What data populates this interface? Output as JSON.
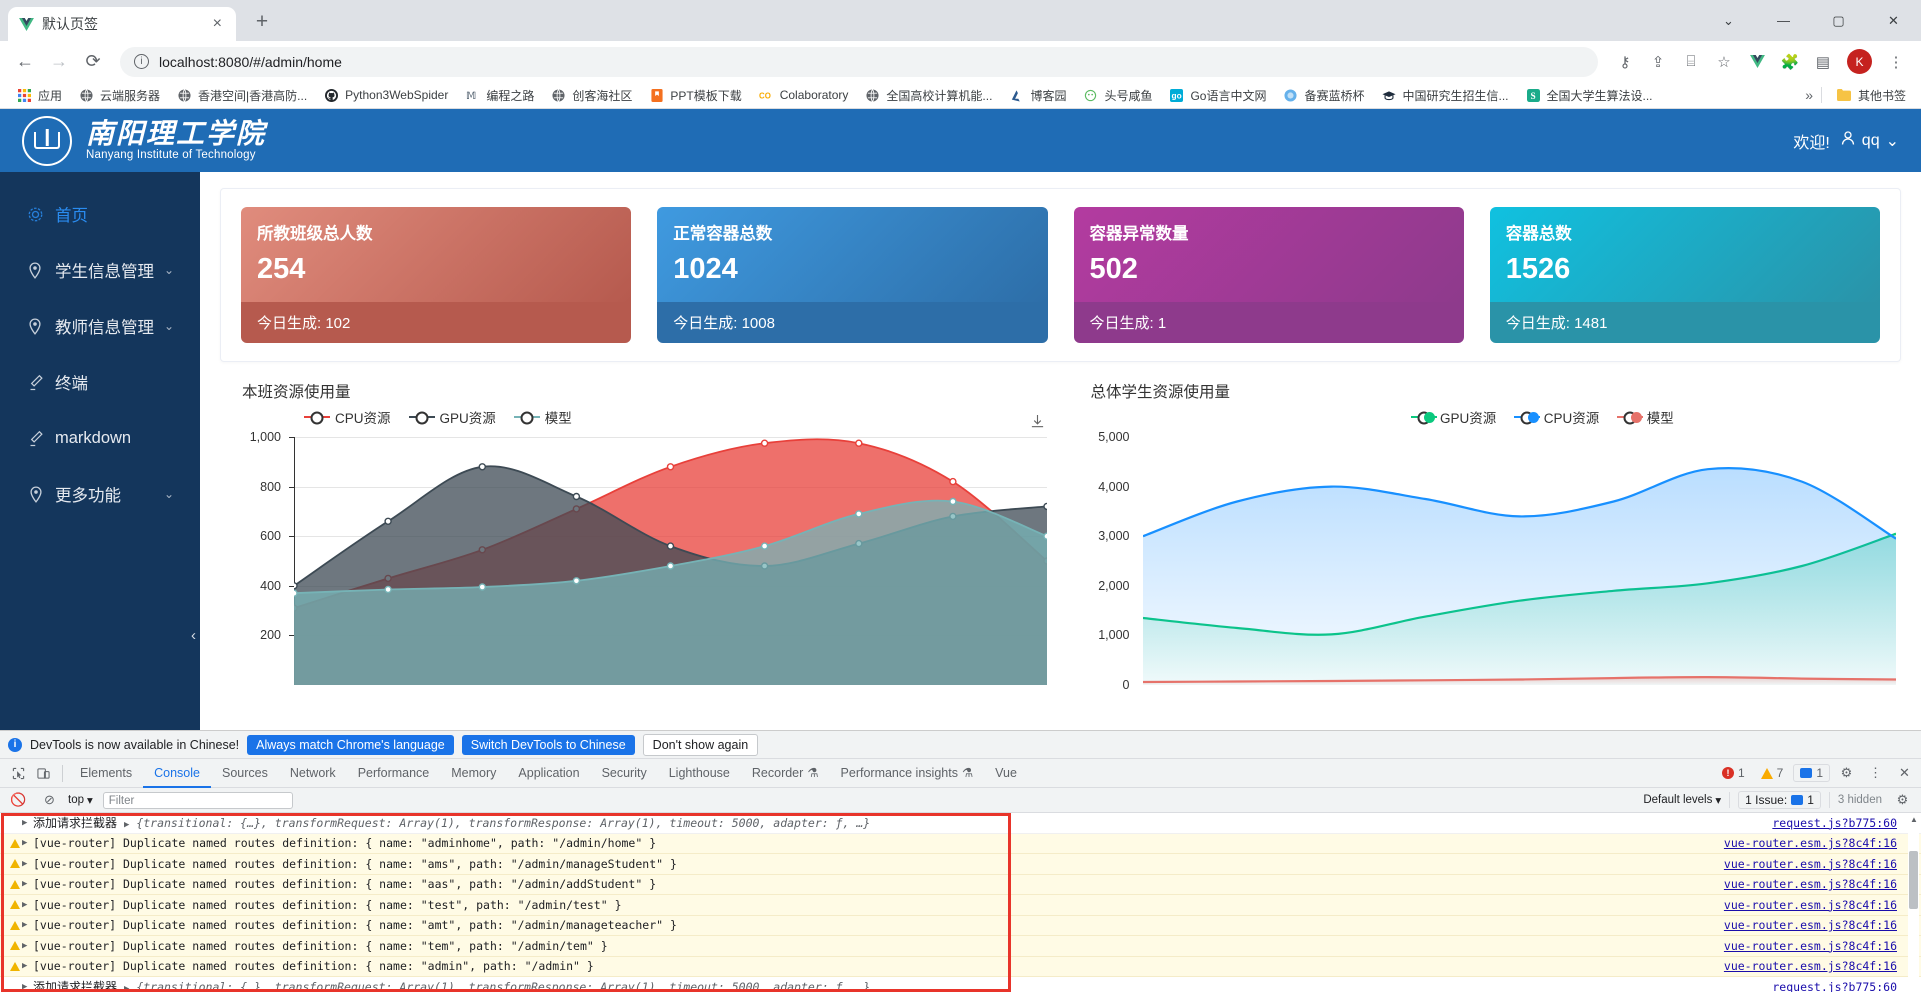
{
  "browser": {
    "tab": {
      "title": "默认页签",
      "favicon": "vue-logo-icon",
      "close": "×"
    },
    "newtab_label": "+",
    "window_controls": {
      "minimize": "—",
      "maximize": "▢",
      "close": "✕",
      "chevron": "⌄"
    },
    "nav": {
      "back": "←",
      "forward": "→",
      "reload": "⟳"
    },
    "omnibox": {
      "host": "localhost:8080",
      "path": "/#/admin/home",
      "full": "localhost:8080/#/admin/home",
      "info_icon": "ⓘ"
    },
    "toolbar_icons": [
      "key-icon",
      "share-icon",
      "cast-icon",
      "star-icon",
      "vue-devtools-icon",
      "extensions-icon",
      "sidepanel-icon"
    ],
    "profile_initials": "K",
    "bookmarks": [
      {
        "label": "应用",
        "icon": "apps-grid-icon"
      },
      {
        "label": "云端服务器",
        "icon": "globe-icon"
      },
      {
        "label": "香港空间|香港高防...",
        "icon": "globe-icon"
      },
      {
        "label": "Python3WebSpider",
        "icon": "github-icon"
      },
      {
        "label": "编程之路",
        "icon": "site-icon"
      },
      {
        "label": "创客海社区",
        "icon": "globe-icon"
      },
      {
        "label": "PPT模板下载",
        "icon": "orange-square-icon"
      },
      {
        "label": "Colaboratory",
        "icon": "colab-icon"
      },
      {
        "label": "全国高校计算机能...",
        "icon": "globe-icon"
      },
      {
        "label": "博客园",
        "icon": "cnblogs-icon"
      },
      {
        "label": "头号咸鱼",
        "icon": "fish-icon"
      },
      {
        "label": "Go语言中文网",
        "icon": "go-icon"
      },
      {
        "label": "备赛蓝桥杯",
        "icon": "blue-circle-icon"
      },
      {
        "label": "中国研究生招生信...",
        "icon": "graduation-cap-icon"
      },
      {
        "label": "全国大学生算法设...",
        "icon": "s-square-icon"
      }
    ],
    "bookmarks_overflow": "»",
    "other_bookmarks": {
      "label": "其他书签",
      "icon": "folder-icon"
    }
  },
  "app": {
    "header": {
      "brand_cn": "南阳理工学院",
      "brand_en": "Nanyang Institute of Technology",
      "welcome": "欢迎!",
      "user": "qq",
      "user_icon": "user-icon",
      "caret": "⌄"
    },
    "sidebar": {
      "collapse_icon": "‹",
      "items": [
        {
          "label": "首页",
          "icon": "gear-icon",
          "active": true,
          "caret": ""
        },
        {
          "label": "学生信息管理",
          "icon": "location-pin-icon",
          "active": false,
          "caret": "⌄"
        },
        {
          "label": "教师信息管理",
          "icon": "location-pin-icon",
          "active": false,
          "caret": "⌄"
        },
        {
          "label": "终端",
          "icon": "pencil-icon",
          "active": false,
          "caret": ""
        },
        {
          "label": "markdown",
          "icon": "pencil-icon",
          "active": false,
          "caret": ""
        },
        {
          "label": "更多功能",
          "icon": "location-pin-icon",
          "active": false,
          "caret": "⌄"
        }
      ]
    },
    "cards": [
      {
        "title": "所教班级总人数",
        "value": "254",
        "foot": "今日生成: 102",
        "c1": "#e08c7d",
        "c2": "#b65a4e"
      },
      {
        "title": "正常容器总数",
        "value": "1024",
        "foot": "今日生成: 1008",
        "c1": "#3f9ae0",
        "c2": "#2d6ea8"
      },
      {
        "title": "容器异常数量",
        "value": "502",
        "foot": "今日生成: 1",
        "c1": "#b33ba0",
        "c2": "#8e3a8c"
      },
      {
        "title": "容器总数",
        "value": "1526",
        "foot": "今日生成: 1481",
        "c1": "#10c1e0",
        "c2": "#2a93a8"
      }
    ],
    "download_icon": "download-icon"
  },
  "chart_data": [
    {
      "type": "area",
      "title": "本班资源使用量",
      "xlabel": "",
      "ylabel": "",
      "ylim": [
        0,
        1000
      ],
      "yticks": [
        "200",
        "400",
        "600",
        "800",
        "1,000"
      ],
      "grid": true,
      "legend_position": "top",
      "x": [
        0,
        1,
        2,
        3,
        4,
        5,
        6,
        7,
        8
      ],
      "series": [
        {
          "name": "CPU资源",
          "color": "#e8403a",
          "values": [
            310,
            430,
            545,
            710,
            880,
            975,
            975,
            820,
            500
          ]
        },
        {
          "name": "GPU资源",
          "color": "#3d4a54",
          "values": [
            400,
            660,
            880,
            760,
            560,
            480,
            570,
            680,
            720
          ]
        },
        {
          "name": "模型",
          "color": "#76b3b6",
          "values": [
            370,
            385,
            395,
            420,
            480,
            560,
            690,
            740,
            600
          ]
        }
      ]
    },
    {
      "type": "area",
      "title": "总体学生资源使用量",
      "xlabel": "",
      "ylabel": "",
      "ylim": [
        0,
        5000
      ],
      "yticks": [
        "0",
        "1,000",
        "2,000",
        "3,000",
        "4,000",
        "5,000"
      ],
      "grid": false,
      "legend_position": "top",
      "x": [
        0,
        1,
        2,
        3,
        4,
        5,
        6,
        7,
        8
      ],
      "series": [
        {
          "name": "GPU资源",
          "color": "#0ac97e",
          "values": [
            1350,
            1150,
            1020,
            1380,
            1700,
            1900,
            2050,
            2400,
            3050
          ]
        },
        {
          "name": "CPU资源",
          "color": "#1890ff",
          "values": [
            3000,
            3700,
            4000,
            3750,
            3400,
            3700,
            4350,
            4100,
            2950
          ]
        },
        {
          "name": "模型",
          "color": "#e6726a",
          "values": [
            60,
            70,
            80,
            95,
            110,
            140,
            160,
            130,
            110
          ]
        }
      ]
    }
  ],
  "devtools": {
    "banner": {
      "text": "DevTools is now available in Chinese!",
      "info_badge": "i",
      "btn_always": "Always match Chrome's language",
      "btn_switch": "Switch DevTools to Chinese",
      "btn_dismiss": "Don't show again"
    },
    "tabs": [
      {
        "label": "Elements",
        "selected": false
      },
      {
        "label": "Console",
        "selected": true
      },
      {
        "label": "Sources",
        "selected": false
      },
      {
        "label": "Network",
        "selected": false
      },
      {
        "label": "Performance",
        "selected": false
      },
      {
        "label": "Memory",
        "selected": false
      },
      {
        "label": "Application",
        "selected": false
      },
      {
        "label": "Security",
        "selected": false
      },
      {
        "label": "Lighthouse",
        "selected": false
      },
      {
        "label": "Recorder",
        "selected": false,
        "beaker": true
      },
      {
        "label": "Performance insights",
        "selected": false,
        "beaker": true
      },
      {
        "label": "Vue",
        "selected": false
      }
    ],
    "counters": {
      "errors": "1",
      "warnings": "7",
      "messages": "1"
    },
    "settings_icon": "gear-icon",
    "more_icon": "kebab-icon",
    "close_icon": "close-icon",
    "inspect_icon": "inspect-icon",
    "device_icon": "device-toolbar-icon",
    "filterbar": {
      "clear_icon": "clear-console-icon",
      "noblock_icon": "no-block-icon",
      "context": "top",
      "context_caret": "▾",
      "filter_placeholder": "Filter",
      "levels": "Default levels",
      "levels_caret": "▾",
      "issues": "1 Issue:",
      "issues_count": "1",
      "hidden": "3 hidden",
      "settings_icon": "gear-icon"
    },
    "logs": [
      {
        "kind": "info",
        "arrow": "▶",
        "cn": "添加请求拦截器",
        "text": "{transitional: {…}, transformRequest: Array(1), transformResponse: Array(1), timeout: 5000, adapter: ƒ, …}",
        "src": "request.js?b775:60"
      },
      {
        "kind": "warn",
        "arrow": "▶",
        "cn": "",
        "text": "[vue-router] Duplicate named routes definition: { name: \"adminhome\", path: \"/admin/home\" }",
        "src": "vue-router.esm.js?8c4f:16"
      },
      {
        "kind": "warn",
        "arrow": "▶",
        "cn": "",
        "text": "[vue-router] Duplicate named routes definition: { name: \"ams\", path: \"/admin/manageStudent\" }",
        "src": "vue-router.esm.js?8c4f:16"
      },
      {
        "kind": "warn",
        "arrow": "▶",
        "cn": "",
        "text": "[vue-router] Duplicate named routes definition: { name: \"aas\", path: \"/admin/addStudent\" }",
        "src": "vue-router.esm.js?8c4f:16"
      },
      {
        "kind": "warn",
        "arrow": "▶",
        "cn": "",
        "text": "[vue-router] Duplicate named routes definition: { name: \"test\", path: \"/admin/test\" }",
        "src": "vue-router.esm.js?8c4f:16"
      },
      {
        "kind": "warn",
        "arrow": "▶",
        "cn": "",
        "text": "[vue-router] Duplicate named routes definition: { name: \"amt\", path: \"/admin/manageteacher\" }",
        "src": "vue-router.esm.js?8c4f:16"
      },
      {
        "kind": "warn",
        "arrow": "▶",
        "cn": "",
        "text": "[vue-router] Duplicate named routes definition: { name: \"tem\", path: \"/admin/tem\" }",
        "src": "vue-router.esm.js?8c4f:16"
      },
      {
        "kind": "warn",
        "arrow": "▶",
        "cn": "",
        "text": "[vue-router] Duplicate named routes definition: { name: \"admin\", path: \"/admin\" }",
        "src": "vue-router.esm.js?8c4f:16"
      },
      {
        "kind": "info",
        "arrow": "▶",
        "cn": "添加请求拦截器",
        "text": "{transitional: {…}, transformRequest: Array(1), transformResponse: Array(1), timeout: 5000, adapter: ƒ, …}",
        "src": "request.js?b775:60"
      }
    ]
  }
}
